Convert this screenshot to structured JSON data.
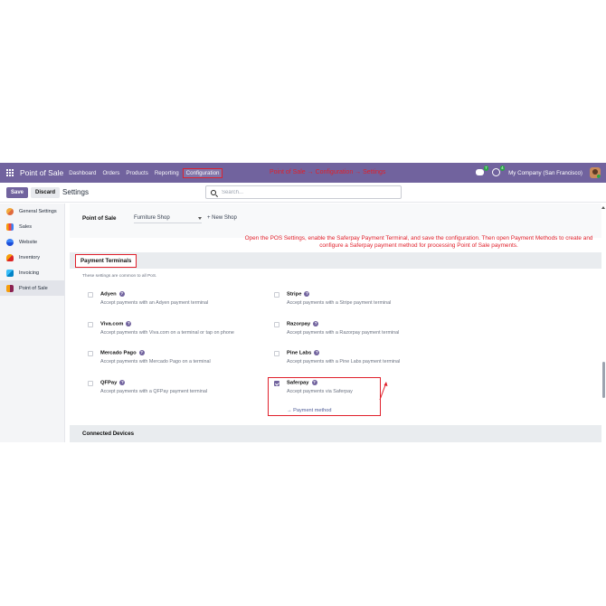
{
  "navbar": {
    "app_title": "Point of Sale",
    "menu": [
      "Dashboard",
      "Orders",
      "Products",
      "Reporting"
    ],
    "active_menu": "Configuration",
    "breadcrumb_note": "Point of Sale → Configuration → Settings",
    "chat_badge": "7",
    "activity_badge": "4",
    "company": "My Company (San Francisco)"
  },
  "control": {
    "save_label": "Save",
    "discard_label": "Discard",
    "title": "Settings",
    "search_placeholder": "Search..."
  },
  "sidebar": {
    "items": [
      {
        "label": "General Settings",
        "icon": "general-settings-icon"
      },
      {
        "label": "Sales",
        "icon": "sales-icon"
      },
      {
        "label": "Website",
        "icon": "website-icon"
      },
      {
        "label": "Inventory",
        "icon": "inventory-icon"
      },
      {
        "label": "Invoicing",
        "icon": "invoicing-icon"
      },
      {
        "label": "Point of Sale",
        "icon": "pos-icon",
        "active": true
      }
    ]
  },
  "pos": {
    "label": "Point of Sale",
    "selected_shop": "Furniture Shop",
    "new_shop_label": "+ New Shop"
  },
  "instruction": "Open the POS Settings, enable the Saferpay Payment Terminal, and save the configuration. Then open Payment Methods to create and configure a Saferpay payment method for processing Point of Sale payments.",
  "section": {
    "title": "Payment Terminals",
    "help_text": "These settings are common to all PoS."
  },
  "terminals": [
    {
      "name": "Adyen",
      "desc": "Accept payments with an Adyen payment terminal",
      "checked": false
    },
    {
      "name": "Stripe",
      "desc": "Accept payments with a Stripe payment terminal",
      "checked": false
    },
    {
      "name": "Viva.com",
      "desc": "Accept payments with Viva.com on a terminal or tap on phone",
      "checked": false
    },
    {
      "name": "Razorpay",
      "desc": "Accept payments with a Razorpay payment terminal",
      "checked": false
    },
    {
      "name": "Mercado Pago",
      "desc": "Accept payments with Mercado Pago on a terminal",
      "checked": false
    },
    {
      "name": "Pine Labs",
      "desc": "Accept payments with a Pine Labs payment terminal",
      "checked": false
    },
    {
      "name": "QFPay",
      "desc": "Accept payments with a QFPay payment terminal",
      "checked": false
    },
    {
      "name": "Saferpay",
      "desc": "Accept payments via Saferpay",
      "checked": true,
      "link": "→ Payment method"
    }
  ],
  "next_section": "Connected Devices",
  "colors": {
    "brand": "#71639e",
    "annotation": "#e0202b"
  }
}
